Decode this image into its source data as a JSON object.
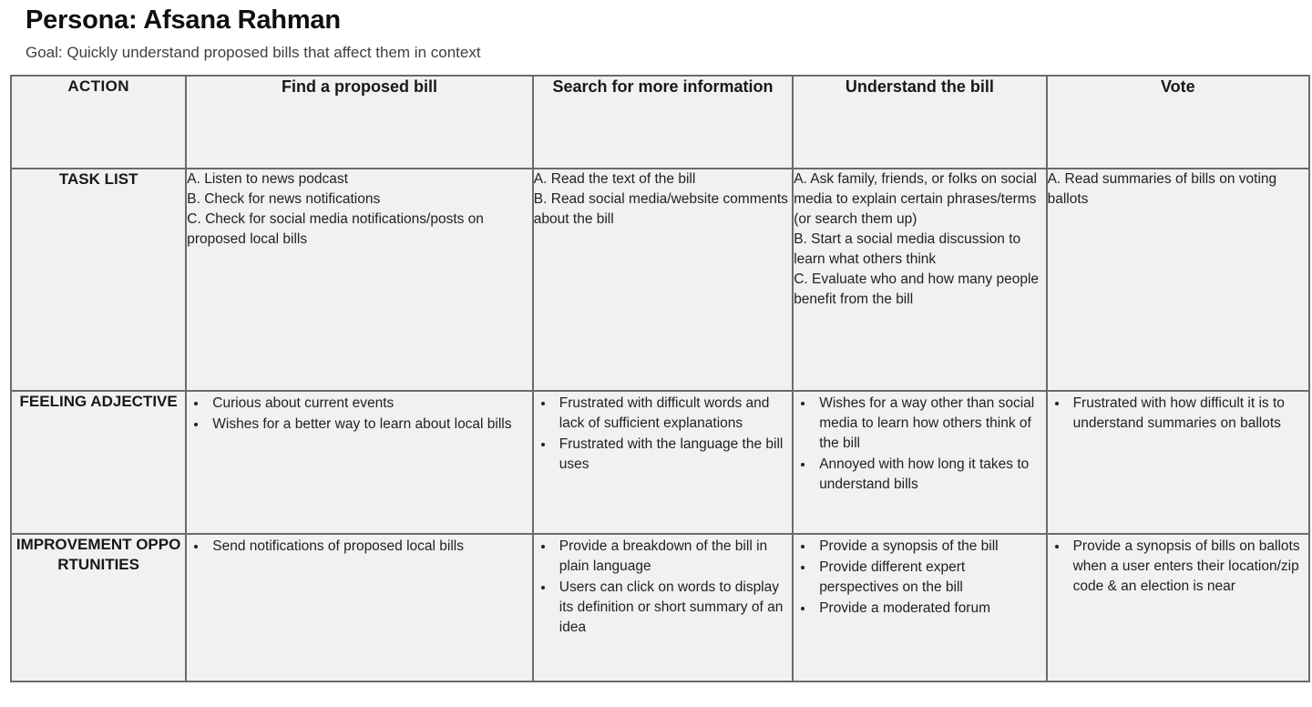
{
  "header": {
    "title": "Persona: Afsana Rahman",
    "goal": "Goal: Quickly understand proposed bills that affect them in context"
  },
  "colors": {
    "header_blue": "#d4e2f8",
    "label_gray": "#f1f1f1",
    "border_gray": "#6b6b6b",
    "text": "#202124"
  },
  "table": {
    "columns": [
      {
        "key": "label",
        "label": "ACTION"
      },
      {
        "key": "find",
        "label": "Find a proposed bill"
      },
      {
        "key": "search",
        "label": "Search for more information"
      },
      {
        "key": "under",
        "label": "Understand the bill"
      },
      {
        "key": "vote",
        "label": "Vote"
      }
    ],
    "rows": [
      {
        "label": "TASK LIST",
        "style": "lettered",
        "cells": {
          "find": [
            "A. Listen to news podcast",
            "B. Check for news notifications",
            "C. Check for social media notifications/posts on proposed local bills"
          ],
          "search": [
            "A. Read the text of the bill",
            "B. Read social media/website comments about the bill"
          ],
          "under": [
            "A. Ask family, friends, or folks on social media to explain certain phrases/terms (or search them up)",
            "B. Start a social media discussion to learn what others think",
            "C. Evaluate who and how many people benefit from the bill"
          ],
          "vote": [
            "A. Read summaries of bills on voting ballots"
          ]
        }
      },
      {
        "label": "FEELING ADJECTIVE",
        "style": "bulleted",
        "cells": {
          "find": [
            "Curious about current events",
            "Wishes for a better way to learn about local bills"
          ],
          "search": [
            "Frustrated with difficult words and lack of sufficient explanations",
            "Frustrated with the language the bill uses"
          ],
          "under": [
            "Wishes for a way other than social media to learn how others think of the bill",
            "Annoyed with how long it takes to understand bills"
          ],
          "vote": [
            "Frustrated with how difficult it is to understand summaries on ballots"
          ]
        }
      },
      {
        "label": "IMPROVEMENT OPPORTUNITIES",
        "style": "bulleted",
        "cells": {
          "find": [
            "Send notifications of proposed local bills"
          ],
          "search": [
            "Provide a breakdown of the bill in plain language",
            "Users can click on words to display its definition or short summary of an idea"
          ],
          "under": [
            "Provide a synopsis of the bill",
            "Provide different expert perspectives on the bill",
            "Provide a moderated forum"
          ],
          "vote": [
            "Provide a synopsis of bills on ballots when a user enters their location/zip code & an election is near"
          ]
        }
      }
    ]
  }
}
